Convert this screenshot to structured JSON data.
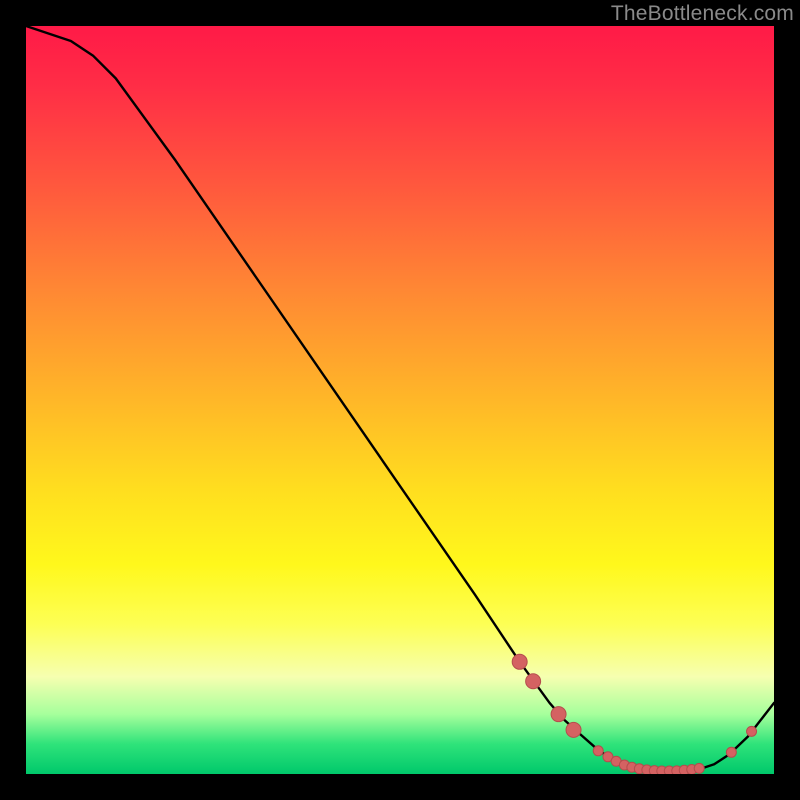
{
  "watermark": "TheBottleneck.com",
  "colors": {
    "background": "#000000",
    "curve": "#000000",
    "dot_fill": "#d46262",
    "dot_stroke": "#b54d4d"
  },
  "chart_data": {
    "type": "line",
    "title": "",
    "xlabel": "",
    "ylabel": "",
    "xlim": [
      0,
      100
    ],
    "ylim": [
      0,
      100
    ],
    "series": [
      {
        "name": "bottleneck-curve",
        "x": [
          0,
          3,
          6,
          9,
          12,
          20,
          30,
          40,
          50,
          60,
          66,
          70,
          72,
          74,
          76.5,
          79,
          81,
          83,
          85,
          87,
          89,
          90.5,
          92,
          94,
          96.5,
          100
        ],
        "y": [
          100,
          99,
          98,
          96,
          93,
          82,
          67.5,
          53,
          38.5,
          24,
          15,
          9.5,
          7.2,
          5.4,
          3.2,
          1.6,
          0.9,
          0.5,
          0.4,
          0.4,
          0.5,
          0.8,
          1.3,
          2.6,
          5.0,
          9.5
        ]
      }
    ],
    "highlight_dots": {
      "name": "bottleneck-markers",
      "large": [
        {
          "x": 66.0,
          "y": 15.0
        },
        {
          "x": 67.8,
          "y": 12.4
        },
        {
          "x": 71.2,
          "y": 8.0
        },
        {
          "x": 73.2,
          "y": 5.9
        }
      ],
      "small": [
        {
          "x": 76.5,
          "y": 3.1
        },
        {
          "x": 77.8,
          "y": 2.3
        },
        {
          "x": 78.9,
          "y": 1.7
        },
        {
          "x": 80.0,
          "y": 1.2
        },
        {
          "x": 81.0,
          "y": 0.9
        },
        {
          "x": 82.0,
          "y": 0.7
        },
        {
          "x": 83.0,
          "y": 0.55
        },
        {
          "x": 84.0,
          "y": 0.45
        },
        {
          "x": 85.0,
          "y": 0.4
        },
        {
          "x": 86.0,
          "y": 0.4
        },
        {
          "x": 87.0,
          "y": 0.42
        },
        {
          "x": 88.0,
          "y": 0.5
        },
        {
          "x": 89.0,
          "y": 0.6
        },
        {
          "x": 90.0,
          "y": 0.75
        },
        {
          "x": 94.3,
          "y": 2.9
        },
        {
          "x": 97.0,
          "y": 5.7
        }
      ]
    }
  }
}
